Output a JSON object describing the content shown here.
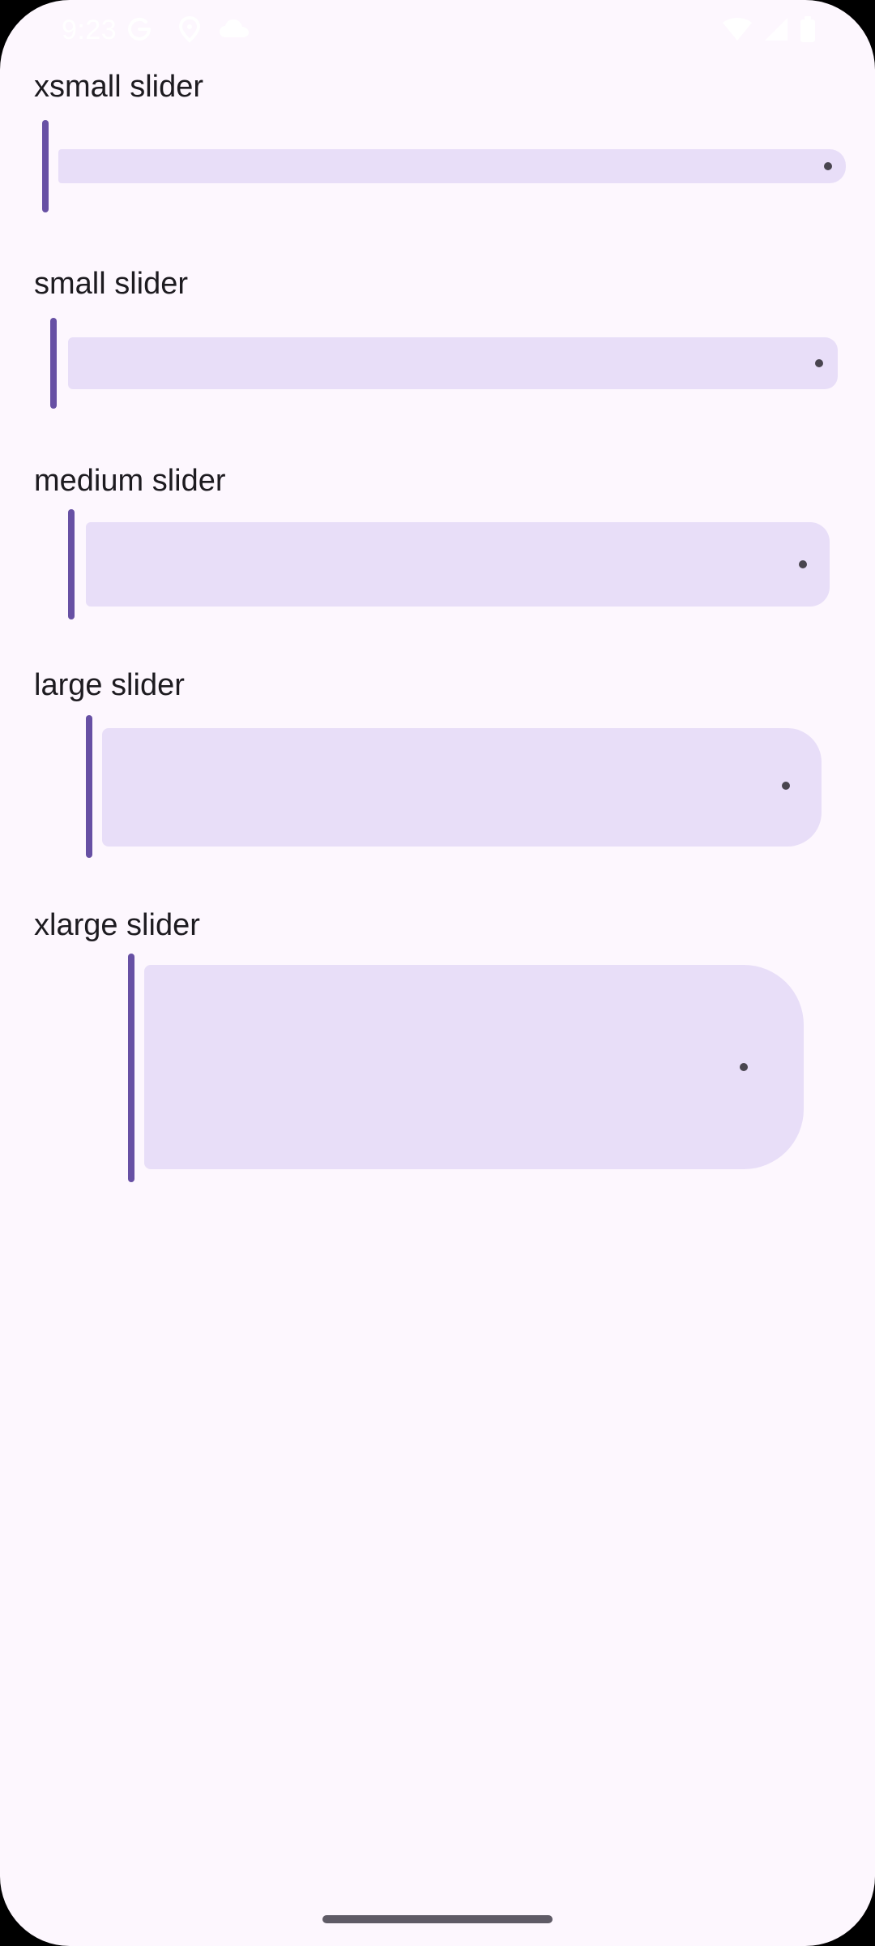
{
  "status_bar": {
    "time": "9:23",
    "icons": [
      "google-g-icon",
      "location-icon",
      "cloud-icon",
      "wifi-icon",
      "signal-icon",
      "battery-icon"
    ]
  },
  "sliders": [
    {
      "label": "xsmall slider",
      "value": 0
    },
    {
      "label": "small slider",
      "value": 0
    },
    {
      "label": "medium slider",
      "value": 0
    },
    {
      "label": "large slider",
      "value": 0
    },
    {
      "label": "xlarge slider",
      "value": 0
    }
  ],
  "colors": {
    "background": "#fdf7fe",
    "handle": "#6750a4",
    "inactive_track": "#e8def8",
    "stop_indicator": "#49454f",
    "text": "#1d1b20"
  }
}
